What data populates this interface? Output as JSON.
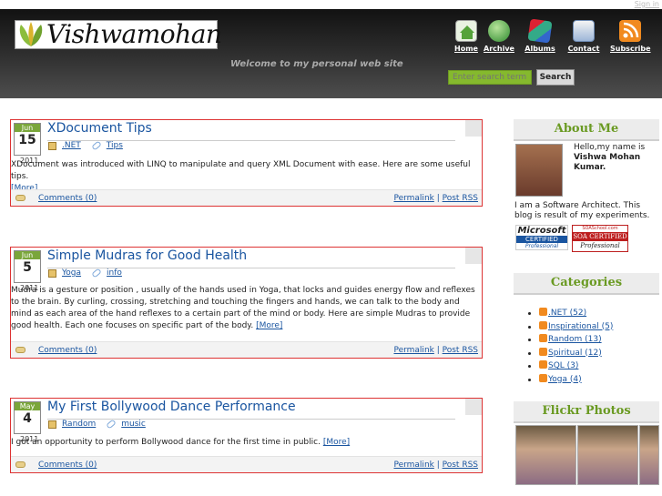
{
  "header": {
    "sign_in": "Sign in",
    "site_title": "Vishwamohan",
    "tagline": "Welcome to my personal web site"
  },
  "nav": [
    {
      "label": "Home",
      "icon": "home-icon",
      "color": "#55a23a"
    },
    {
      "label": "Archive",
      "icon": "globe-icon",
      "color": "#2e8a2f"
    },
    {
      "label": "Albums",
      "icon": "albums-icon",
      "color": "#b77a22"
    },
    {
      "label": "Contact",
      "icon": "contact-icon",
      "color": "#4b76b0"
    },
    {
      "label": "Subscribe",
      "icon": "rss-icon",
      "color": "#f18a1f"
    }
  ],
  "search": {
    "placeholder": "Enter search term",
    "button": "Search"
  },
  "posts": [
    {
      "month": "Jun",
      "day": "15",
      "year": "2011",
      "title": "XDocument Tips",
      "category": ".NET",
      "tag": "Tips",
      "body": "XDocument was introduced with LINQ to manipulate and query XML Document with ease. Here are some useful tips.",
      "more": "[More]",
      "comments": "Comments (0)",
      "permalink": "Permalink",
      "rss": "Post RSS"
    },
    {
      "month": "Jun",
      "day": "5",
      "year": "2011",
      "title": "Simple Mudras for Good Health",
      "category": "Yoga",
      "tag": "info",
      "body": "Mudra is a gesture or position , usually of the hands used in Yoga, that locks and guides energy flow and reflexes to the brain. By curling, crossing, stretching and touching the fingers and hands, we can talk to the body and mind as each area of the hand reflexes to a certain part of the mind or body. Here are simple Mudras to provide good health. Each one focuses on specific part of the body.",
      "more": "[More]",
      "comments": "Comments (0)",
      "permalink": "Permalink",
      "rss": "Post RSS"
    },
    {
      "month": "May",
      "day": "4",
      "year": "2011",
      "title": "My First Bollywood Dance Performance",
      "category": "Random",
      "tag": "music",
      "body": "I got an opportunity to perform Bollywood dance for the first time in public.",
      "more": "[More]",
      "comments": "Comments (0)",
      "permalink": "Permalink",
      "rss": "Post RSS"
    }
  ],
  "sidebar": {
    "about_title": "About Me",
    "about_intro": "Hello,my name is",
    "about_name": "Vishwa Mohan Kumar.",
    "about_body": "I am a Software Architect. This blog is result of my experiments.",
    "ms_badge": {
      "line1": "Microsoft",
      "line2": "CERTIFIED",
      "line3": "Professional"
    },
    "soa_badge": {
      "line1": "SOASchool.com",
      "line2": "SOA CERTIFIED",
      "line3": "Professional"
    },
    "categories_title": "Categories",
    "categories": [
      ".NET (52)",
      "Inspirational (5)",
      "Random (13)",
      "Spiritual (12)",
      "SQL (3)",
      "Yoga (4)"
    ],
    "flickr_title": "Flickr Photos"
  },
  "colors": {
    "accent_green": "#6a9a22",
    "link": "#1a55a0",
    "post_border": "#dd3333"
  }
}
